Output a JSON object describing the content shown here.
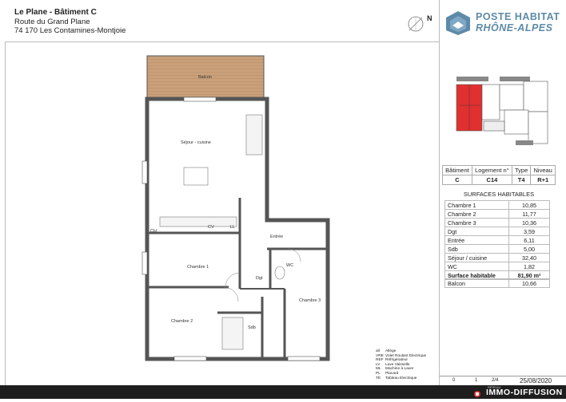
{
  "header": {
    "title": "Le Plane - Bâtiment C",
    "address1": "Route du Grand Plane",
    "address2": "74 170 Les Contamines-Montjoie"
  },
  "compass": {
    "letter": "N"
  },
  "logo": {
    "line1": "POSTE HABITAT",
    "line2": "RHÔNE-ALPES",
    "color": "#5d8aa8"
  },
  "info_table": {
    "headers": [
      "Bâtiment",
      "Logement n°",
      "Type",
      "Niveau"
    ],
    "values": [
      "C",
      "C14",
      "T4",
      "R+1"
    ]
  },
  "surfaces": {
    "title": "SURFACES HABITABLES",
    "rows": [
      {
        "label": "Chambre 1",
        "value": "10,85"
      },
      {
        "label": "Chambre 2",
        "value": "11,77"
      },
      {
        "label": "Chambre 3",
        "value": "10,36"
      },
      {
        "label": "Dgt",
        "value": "3,59"
      },
      {
        "label": "Entrée",
        "value": "6,11"
      },
      {
        "label": "Sdb",
        "value": "5,00"
      },
      {
        "label": "Séjour / cuisine",
        "value": "32,40"
      },
      {
        "label": "WC",
        "value": "1,82"
      }
    ],
    "total": {
      "label": "Surface habitable",
      "value": "81,90 m²"
    },
    "balcony": {
      "label": "Balcon",
      "value": "10,66"
    }
  },
  "plan": {
    "balcon": "Balcon",
    "sejour": "Séjour - cuisine",
    "entree": "Entrée",
    "chambre1": "Chambre 1",
    "chambre2": "Chambre 2",
    "chambre3": "Chambre 3",
    "dgt": "Dgt",
    "wc": "WC",
    "sdb": "Sdb",
    "ch": "CH",
    "cv": "CV",
    "ll": "LL",
    "pl": "PL"
  },
  "legend": [
    {
      "code": "all",
      "text": "Allège"
    },
    {
      "code": "VRE",
      "text": "Volet Roulant Electrique"
    },
    {
      "code": "REF",
      "text": "Réfrigérateur"
    },
    {
      "code": "LV",
      "text": "Lave Vaisselle"
    },
    {
      "code": "ML",
      "text": "Machine à Laver"
    },
    {
      "code": "PL",
      "text": "Placard"
    },
    {
      "code": "TE",
      "text": "Tableau Electrique"
    }
  ],
  "bottom_row": {
    "a": "0",
    "b": "1",
    "c": "2/4",
    "date": "25/08/2020"
  },
  "footer": {
    "brand": "IMMO-DIFFUSION",
    "small": "RÉSEAU"
  },
  "colors": {
    "highlight": "#e03030",
    "wood": "#c9a07a",
    "footer_bg": "#1e1e1e"
  }
}
